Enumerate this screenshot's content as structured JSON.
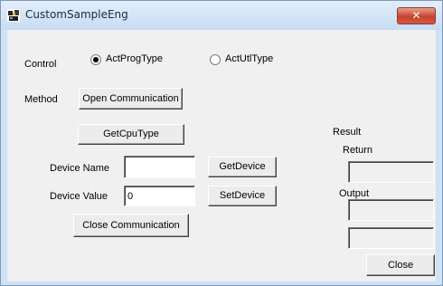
{
  "window": {
    "title": "CustomSampleEng",
    "close_glyph": "✕"
  },
  "control": {
    "label": "Control",
    "options": [
      {
        "label": "ActProgType",
        "selected": true
      },
      {
        "label": "ActUtlType",
        "selected": false
      }
    ]
  },
  "method": {
    "label": "Method",
    "open_button": "Open Communication"
  },
  "get_cpu_button": "GetCpuType",
  "device": {
    "name_label": "Device Name",
    "name_value": "",
    "get_button": "GetDevice",
    "value_label": "Device Value",
    "value_value": "0",
    "set_button": "SetDevice"
  },
  "close_comm_button": "Close  Communication",
  "result": {
    "label": "Result",
    "return_label": "Return",
    "return_value": "",
    "output_label": "Output",
    "output_value_1": "",
    "output_value_2": ""
  },
  "close_button": "Close"
}
